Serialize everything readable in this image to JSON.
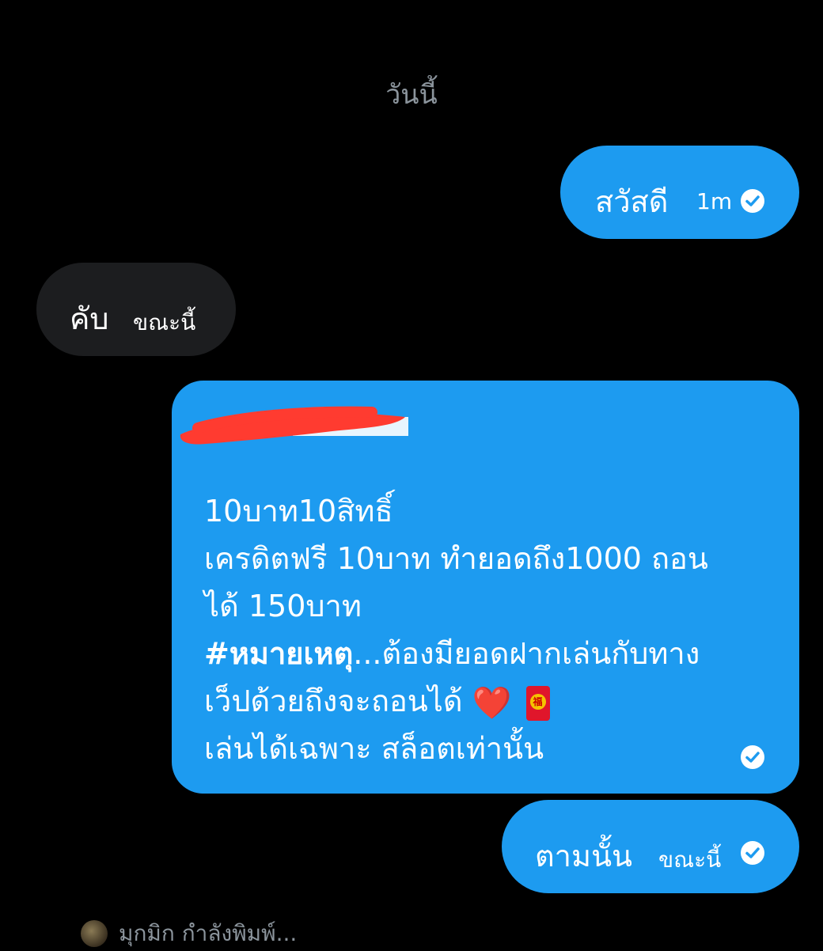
{
  "chat": {
    "date_separator": "วันนี้",
    "messages": [
      {
        "direction": "outgoing",
        "text": "สวัสดี",
        "time": "1m",
        "status": "read-check-icon"
      },
      {
        "direction": "incoming",
        "text": "คับ",
        "time": "ขณะนี้"
      },
      {
        "direction": "outgoing",
        "lines": [
          "10บาท10สิทธิ์",
          "เครดิตฟรี 10บาท ทำยอดถึง1000 ถอน",
          "ได้ 150บาท",
          "#หมายเหตุ",
          "...ต้องมียอดฝากเล่นกับทาง",
          "เว็ปด้วยถึงจะถอนได้",
          "❤️",
          "福",
          "เล่นได้เฉพาะ สล็อตเท่านั้น"
        ],
        "status": "read-check-icon"
      },
      {
        "direction": "outgoing",
        "text": "ตามนั้น",
        "time": "ขณะนี้",
        "status": "read-check-icon"
      }
    ],
    "typing_indicator": "มุกมิก กำลังพิมพ์..."
  },
  "colors": {
    "background": "#000000",
    "outgoing_bubble": "#1d9bf0",
    "incoming_bubble": "#1c1d1f",
    "muted_text": "#8b949c",
    "redaction": "#ff3b30"
  }
}
